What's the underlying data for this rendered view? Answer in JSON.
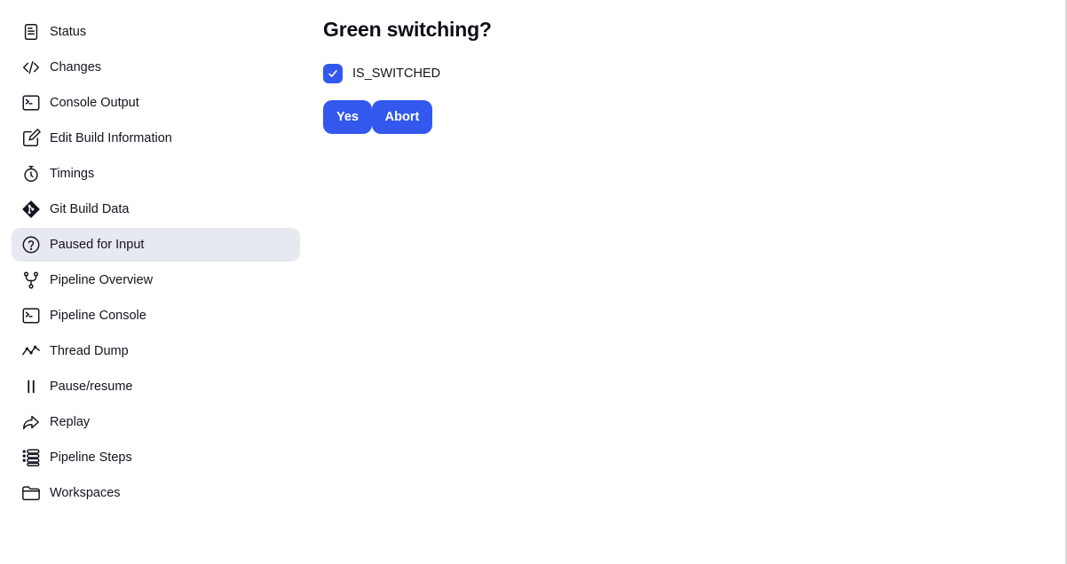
{
  "sidebar": {
    "items": [
      {
        "label": "Status",
        "icon": "status-icon",
        "active": false
      },
      {
        "label": "Changes",
        "icon": "code-icon",
        "active": false
      },
      {
        "label": "Console Output",
        "icon": "terminal-icon",
        "active": false
      },
      {
        "label": "Edit Build Information",
        "icon": "edit-icon",
        "active": false
      },
      {
        "label": "Timings",
        "icon": "stopwatch-icon",
        "active": false
      },
      {
        "label": "Git Build Data",
        "icon": "git-icon",
        "active": false
      },
      {
        "label": "Paused for Input",
        "icon": "question-icon",
        "active": true
      },
      {
        "label": "Pipeline Overview",
        "icon": "branch-icon",
        "active": false
      },
      {
        "label": "Pipeline Console",
        "icon": "terminal-icon",
        "active": false
      },
      {
        "label": "Thread Dump",
        "icon": "activity-icon",
        "active": false
      },
      {
        "label": "Pause/resume",
        "icon": "pause-icon",
        "active": false
      },
      {
        "label": "Replay",
        "icon": "replay-icon",
        "active": false
      },
      {
        "label": "Pipeline Steps",
        "icon": "list-icon",
        "active": false
      },
      {
        "label": "Workspaces",
        "icon": "folder-icon",
        "active": false
      }
    ]
  },
  "main": {
    "title": "Green switching?",
    "parameter": {
      "label": "IS_SWITCHED",
      "checked": true
    },
    "yes_label": "Yes",
    "abort_label": "Abort"
  },
  "colors": {
    "accent": "#3358ee",
    "active_bg": "#e7e9f1",
    "text": "#14141f"
  }
}
